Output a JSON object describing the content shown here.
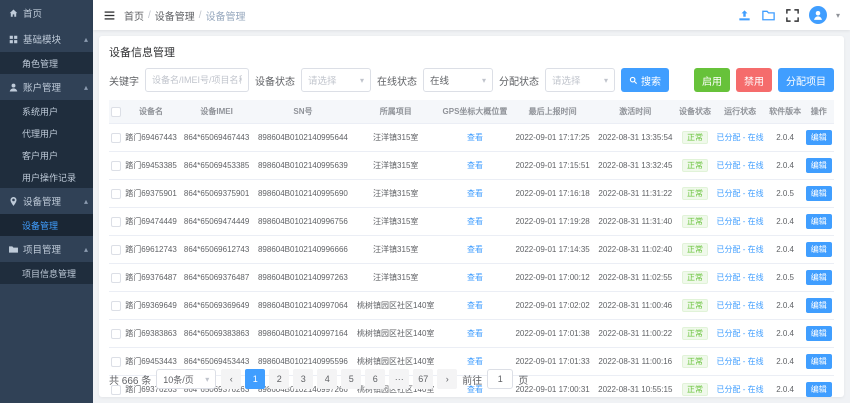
{
  "sidebar": {
    "home": "首页",
    "groups": [
      {
        "label": "基础模块",
        "children": [
          "角色管理"
        ]
      },
      {
        "label": "账户管理",
        "children": [
          "系统用户",
          "代理用户",
          "客户用户",
          "用户操作记录"
        ]
      },
      {
        "label": "设备管理",
        "children": [
          "设备管理"
        ]
      },
      {
        "label": "项目管理",
        "children": [
          "项目信息管理"
        ]
      }
    ]
  },
  "header": {
    "breadcrumb": [
      "首页",
      "设备管理",
      "设备管理"
    ]
  },
  "page": {
    "title": "设备信息管理"
  },
  "filters": {
    "keyword_label": "关键字",
    "keyword_placeholder": "设备名/IMEI号/项目名称",
    "device_status_label": "设备状态",
    "device_status_value": "请选择",
    "online_status_label": "在线状态",
    "online_status_value": "在线",
    "assign_status_label": "分配状态",
    "assign_status_value": "请选择",
    "search_label": "搜索"
  },
  "toolbar": {
    "enable_label": "启用",
    "disable_label": "禁用",
    "assign_label": "分配项目"
  },
  "table": {
    "columns": [
      "设备名",
      "设备IMEI",
      "SN号",
      "所属项目",
      "GPS坐标大概位置",
      "最后上报时间",
      "激活时间",
      "设备状态",
      "运行状态",
      "软件版本",
      "操作"
    ],
    "view_label": "查看",
    "edit_label": "编辑",
    "rows": [
      {
        "name": "踏门69467443",
        "imei": "864*65069467443",
        "sn": "898604B0102140995644",
        "project": "汪洋镇315室",
        "last_report": "2022-09-01 17:17:25",
        "activated": "2022-08-31 13:35:54",
        "status": "正常",
        "run_status": "已分配 - 在线",
        "version": "2.0.4"
      },
      {
        "name": "踏门69453385",
        "imei": "864*65069453385",
        "sn": "898604B0102140995639",
        "project": "汪洋镇315室",
        "last_report": "2022-09-01 17:15:51",
        "activated": "2022-08-31 13:32:45",
        "status": "正常",
        "run_status": "已分配 - 在线",
        "version": "2.0.4"
      },
      {
        "name": "踏门69375901",
        "imei": "864*65069375901",
        "sn": "898604B0102140995690",
        "project": "汪洋镇315室",
        "last_report": "2022-09-01 17:16:18",
        "activated": "2022-08-31 11:31:22",
        "status": "正常",
        "run_status": "已分配 - 在线",
        "version": "2.0.5"
      },
      {
        "name": "踏门69474449",
        "imei": "864*65069474449",
        "sn": "898604B0102140996756",
        "project": "汪洋镇315室",
        "last_report": "2022-09-01 17:19:28",
        "activated": "2022-08-31 11:31:40",
        "status": "正常",
        "run_status": "已分配 - 在线",
        "version": "2.0.4"
      },
      {
        "name": "踏门69612743",
        "imei": "864*65069612743",
        "sn": "898604B0102140996666",
        "project": "汪洋镇315室",
        "last_report": "2022-09-01 17:14:35",
        "activated": "2022-08-31 11:02:40",
        "status": "正常",
        "run_status": "已分配 - 在线",
        "version": "2.0.4"
      },
      {
        "name": "踏门69376487",
        "imei": "864*65069376487",
        "sn": "898604B0102140997263",
        "project": "汪洋镇315室",
        "last_report": "2022-09-01 17:00:12",
        "activated": "2022-08-31 11:02:55",
        "status": "正常",
        "run_status": "已分配 - 在线",
        "version": "2.0.5"
      },
      {
        "name": "踏门69369649",
        "imei": "864*65069369649",
        "sn": "898604B0102140997064",
        "project": "桃树镇园区社区140室",
        "last_report": "2022-09-01 17:02:02",
        "activated": "2022-08-31 11:00:46",
        "status": "正常",
        "run_status": "已分配 - 在线",
        "version": "2.0.4"
      },
      {
        "name": "踏门69383863",
        "imei": "864*65069383863",
        "sn": "898604B0102140997164",
        "project": "桃树镇园区社区140室",
        "last_report": "2022-09-01 17:01:38",
        "activated": "2022-08-31 11:00:22",
        "status": "正常",
        "run_status": "已分配 - 在线",
        "version": "2.0.4"
      },
      {
        "name": "踏门69453443",
        "imei": "864*65069453443",
        "sn": "898604B0102140995596",
        "project": "桃树镇园区社区140室",
        "last_report": "2022-09-01 17:01:33",
        "activated": "2022-08-31 11:00:16",
        "status": "正常",
        "run_status": "已分配 - 在线",
        "version": "2.0.4"
      },
      {
        "name": "踏门69376263",
        "imei": "864*65069376263",
        "sn": "898604B0102140997266",
        "project": "桃树镇园区社区140室",
        "last_report": "2022-09-01 17:00:31",
        "activated": "2022-08-31 10:55:15",
        "status": "正常",
        "run_status": "已分配 - 在线",
        "version": "2.0.4"
      }
    ]
  },
  "pagination": {
    "total": "共 666 条",
    "page_size": "10条/页",
    "prev_icon": "‹",
    "next_icon": "›",
    "pages": [
      "1",
      "2",
      "3",
      "4",
      "5",
      "6",
      "···",
      "67"
    ],
    "active_page": "1",
    "goto_label": "前往",
    "goto_value": "1",
    "goto_suffix": "页"
  },
  "colors": {
    "primary": "#409eff",
    "success": "#67c23a",
    "danger": "#f56c6c",
    "sidebar_bg": "#304156"
  }
}
